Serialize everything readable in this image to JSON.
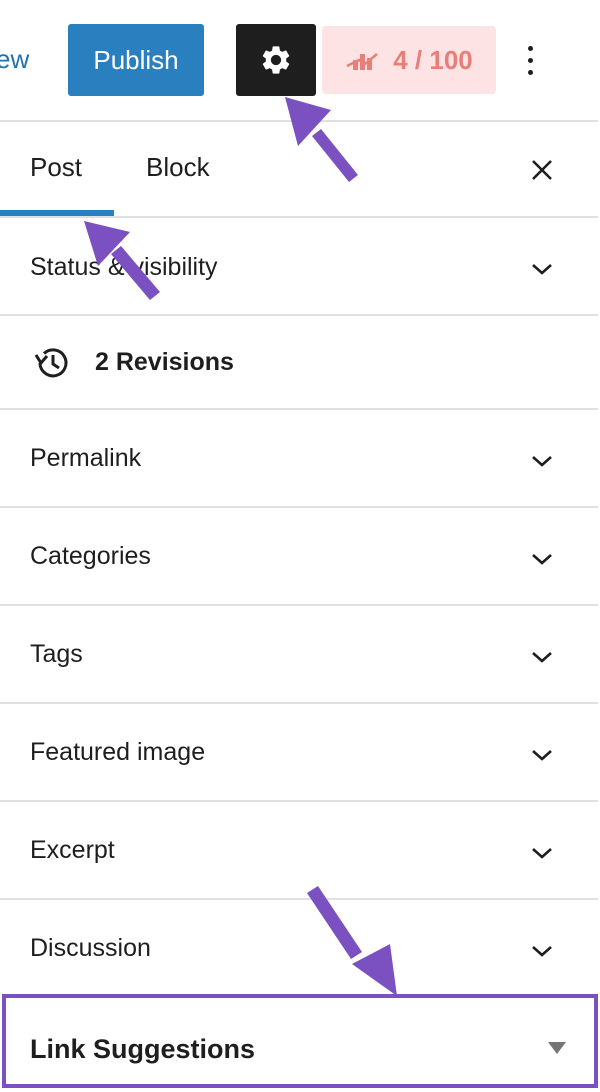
{
  "toolbar": {
    "preview_label": "ew",
    "publish_label": "Publish",
    "score_text": "4 / 100"
  },
  "tabs": {
    "post_label": "Post",
    "block_label": "Block"
  },
  "panels": [
    {
      "label": "Status & visibility"
    },
    {
      "label": "2 Revisions"
    },
    {
      "label": "Permalink"
    },
    {
      "label": "Categories"
    },
    {
      "label": "Tags"
    },
    {
      "label": "Featured image"
    },
    {
      "label": "Excerpt"
    },
    {
      "label": "Discussion"
    }
  ],
  "link_suggestions": {
    "label": "Link Suggestions"
  },
  "colors": {
    "publish": "#2a7fbf",
    "settings_active": "#1e1e1e",
    "score_bg": "#fde3e3",
    "score_text": "#e87e78",
    "annotation": "#7b51c2"
  },
  "icons": {
    "settings": "gear-icon",
    "score": "seo-score-icon",
    "more": "vertical-ellipsis-icon",
    "close": "close-icon",
    "revisions": "history-icon",
    "expand": "chevron-down-icon",
    "collapse": "caret-down-icon"
  }
}
